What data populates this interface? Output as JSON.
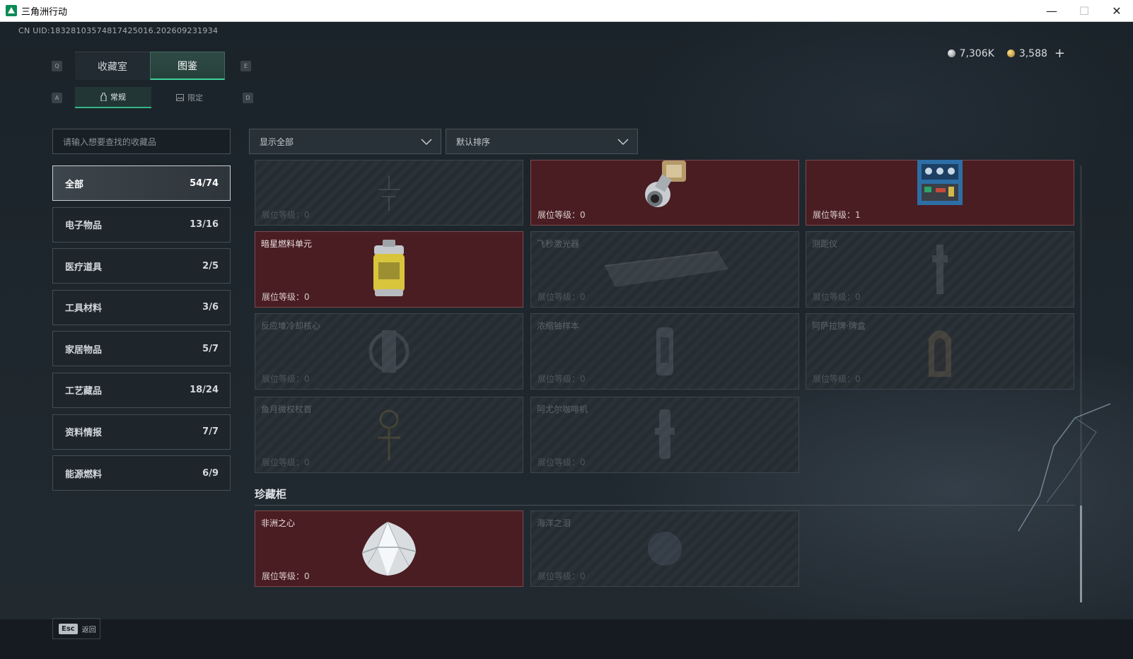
{
  "window": {
    "title": "三角洲行动",
    "minimize": "—",
    "maximize": "☐",
    "close": "✕"
  },
  "uid": "CN UID:18328103574817425016.202609231934",
  "currency": {
    "silver": "7,306K",
    "gold": "3,588",
    "plus": "+"
  },
  "keys": {
    "q": "Q",
    "e": "E",
    "a": "A",
    "d": "D"
  },
  "tabs": {
    "main": [
      "收藏室",
      "图鉴"
    ],
    "sub": [
      "常规",
      "限定"
    ]
  },
  "search": {
    "placeholder": "请输入想要查找的收藏品"
  },
  "filters": {
    "show": "显示全部",
    "sort": "默认排序"
  },
  "categories": [
    {
      "label": "全部",
      "count": "54/74"
    },
    {
      "label": "电子物品",
      "count": "13/16"
    },
    {
      "label": "医疗道具",
      "count": "2/5"
    },
    {
      "label": "工具材料",
      "count": "3/6"
    },
    {
      "label": "家居物品",
      "count": "5/7"
    },
    {
      "label": "工艺藏品",
      "count": "18/24"
    },
    {
      "label": "资料情报",
      "count": "7/7"
    },
    {
      "label": "能源燃料",
      "count": "6/9"
    }
  ],
  "items": [
    {
      "name": "",
      "level": "展位等级：0",
      "owned": false,
      "icon": "lamp-icon"
    },
    {
      "name": "",
      "level": "展位等级：0",
      "owned": true,
      "icon": "motor-icon"
    },
    {
      "name": "",
      "level": "展位等级：1",
      "owned": true,
      "icon": "server-icon"
    },
    {
      "name": "暗星燃料单元",
      "level": "展位等级：0",
      "owned": true,
      "icon": "fuel-cell-icon"
    },
    {
      "name": "飞秒激光器",
      "level": "展位等级：0",
      "owned": false,
      "icon": "laser-icon"
    },
    {
      "name": "测距仪",
      "level": "展位等级：0",
      "owned": false,
      "icon": "rangefinder-icon"
    },
    {
      "name": "反应堆冷却核心",
      "level": "展位等级：0",
      "owned": false,
      "icon": "reactor-icon"
    },
    {
      "name": "浓缩铀样本",
      "level": "展位等级：0",
      "owned": false,
      "icon": "uranium-icon"
    },
    {
      "name": "阿萨拉牌·牌盒",
      "level": "展位等级：0",
      "owned": false,
      "icon": "card-box-icon"
    },
    {
      "name": "鱼月微权杖首",
      "level": "展位等级：0",
      "owned": false,
      "icon": "scepter-icon"
    },
    {
      "name": "阿尤尔咖啡机",
      "level": "展位等级：0",
      "owned": false,
      "icon": "coffee-machine-icon"
    }
  ],
  "showcase": {
    "title": "珍藏柜",
    "items": [
      {
        "name": "非洲之心",
        "level": "展位等级：0",
        "owned": true,
        "icon": "diamond-icon"
      },
      {
        "name": "海洋之泪",
        "level": "展位等级：0",
        "owned": false,
        "icon": "gem-icon"
      }
    ]
  },
  "footer": {
    "esc_key": "Esc",
    "back": "返回"
  },
  "colors": {
    "owned_bg": "#4a1d22",
    "accent_green": "#3fd49a",
    "locked_bg": "#252c32"
  }
}
